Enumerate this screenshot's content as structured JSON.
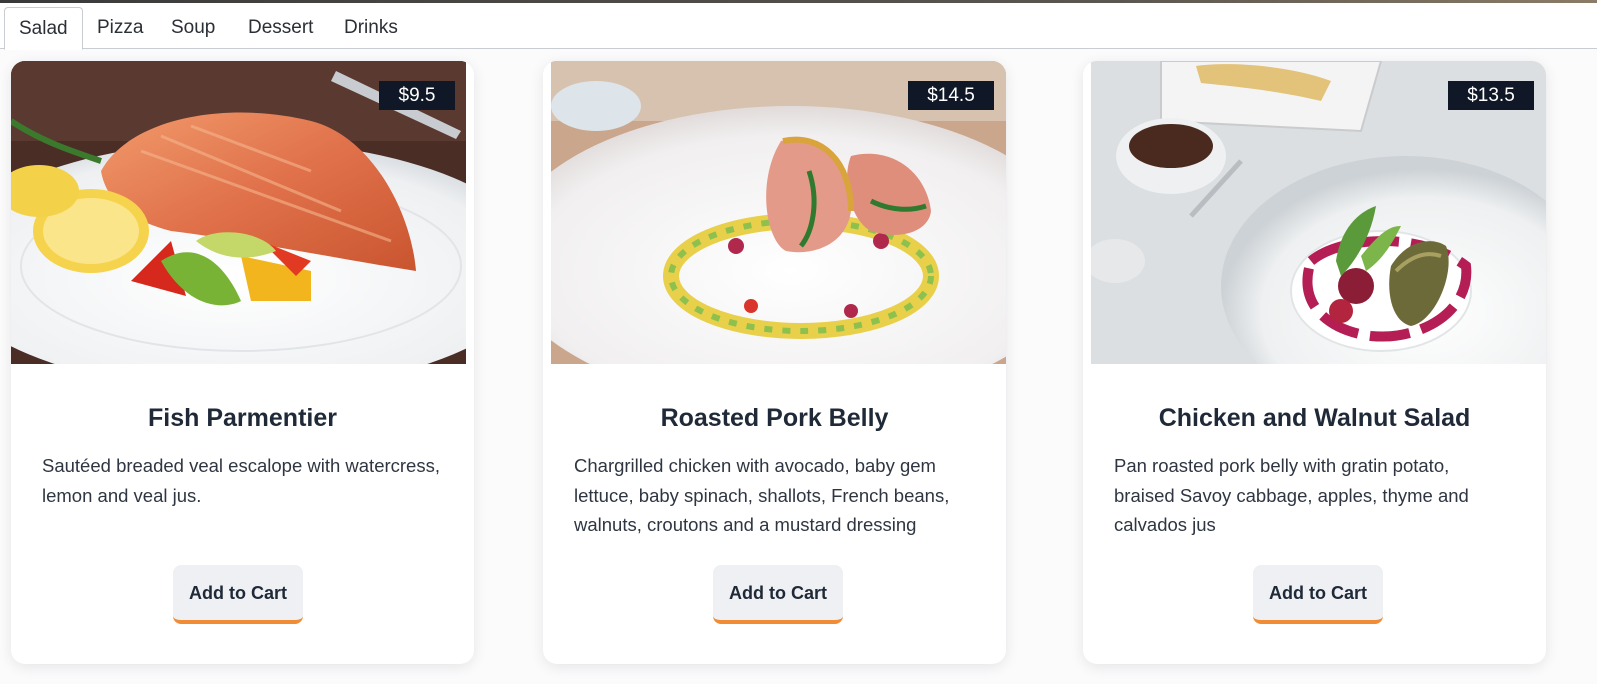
{
  "tabs": [
    {
      "label": "Salad",
      "active": true
    },
    {
      "label": "Pizza",
      "active": false
    },
    {
      "label": "Soup",
      "active": false
    },
    {
      "label": "Dessert",
      "active": false
    },
    {
      "label": "Drinks",
      "active": false
    }
  ],
  "items": [
    {
      "price": "$9.5",
      "name": "Fish Parmentier",
      "description": "Sautéed breaded veal escalope with watercress, lemon and veal jus.",
      "button": "Add to Cart"
    },
    {
      "price": "$14.5",
      "name": "Roasted Pork Belly",
      "description": "Chargrilled chicken with avocado, baby gem lettuce, baby spinach, shallots, French beans, walnuts, croutons and a mustard dressing",
      "button": "Add to Cart"
    },
    {
      "price": "$13.5",
      "name": "Chicken and Walnut Salad",
      "description": "Pan roasted pork belly with gratin potato, braised Savoy cabbage, apples, thyme and calvados jus",
      "button": "Add to Cart"
    }
  ],
  "colors": {
    "price_badge_bg": "#101828",
    "button_accent": "#f08c35",
    "button_bg": "#eef0f4"
  }
}
